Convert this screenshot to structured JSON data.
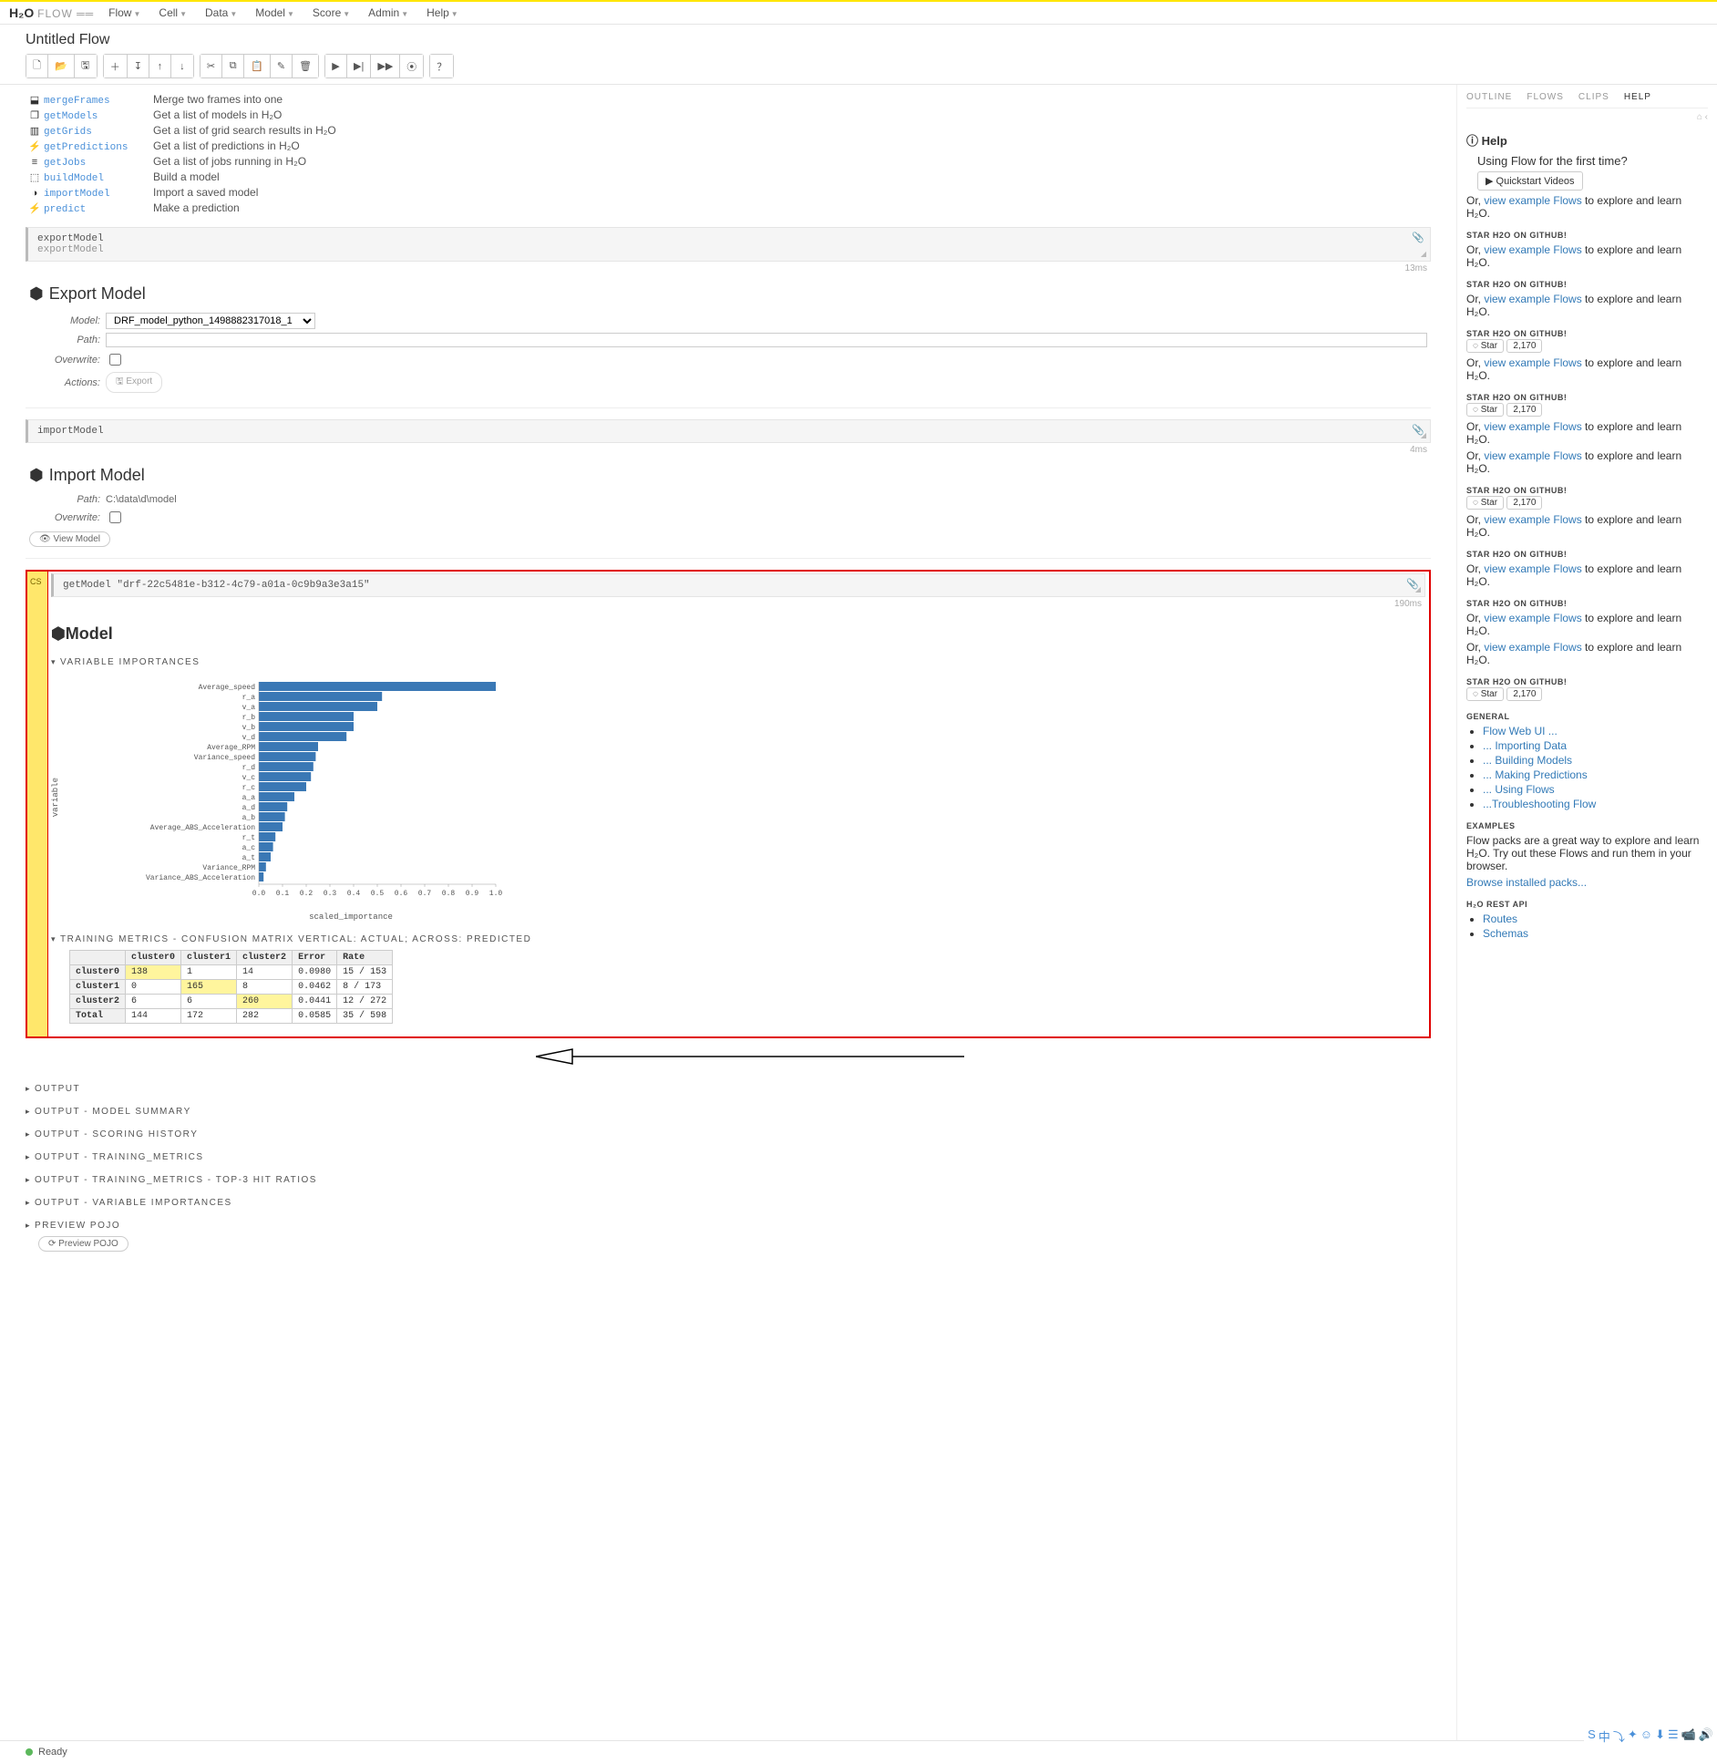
{
  "app": {
    "logo_main": "H₂O",
    "logo_sub": "FLOW",
    "title": "Untitled Flow"
  },
  "menus": [
    "Flow",
    "Cell",
    "Data",
    "Model",
    "Score",
    "Admin",
    "Help"
  ],
  "toolbar_groups": [
    [
      "new-file",
      "open-file",
      "save-file"
    ],
    [
      "insert-above",
      "insert-below",
      "move-up",
      "move-down"
    ],
    [
      "cut",
      "copy",
      "paste",
      "edit",
      "delete"
    ],
    [
      "run",
      "run-next",
      "run-all",
      "interrupt"
    ],
    [
      "help"
    ]
  ],
  "toolbar_icons": {
    "new-file": "🗋",
    "open-file": "📂",
    "save-file": "🖫",
    "insert-above": "＋",
    "insert-below": "↧",
    "move-up": "↑",
    "move-down": "↓",
    "cut": "✂",
    "copy": "⧉",
    "paste": "📋",
    "edit": "✎",
    "delete": "🗑",
    "run": "▶",
    "run-next": "▶|",
    "run-all": "▶▶",
    "interrupt": "⦿",
    "help": "？"
  },
  "commands": [
    {
      "icon": "⬓",
      "name": "mergeFrames",
      "desc": "Merge two frames into one"
    },
    {
      "icon": "❐",
      "name": "getModels",
      "desc": "Get a list of models in H₂O"
    },
    {
      "icon": "▥",
      "name": "getGrids",
      "desc": "Get a list of grid search results in H₂O"
    },
    {
      "icon": "⚡",
      "name": "getPredictions",
      "desc": "Get a list of predictions in H₂O"
    },
    {
      "icon": "≡",
      "name": "getJobs",
      "desc": "Get a list of jobs running in H₂O"
    },
    {
      "icon": "⬚",
      "name": "buildModel",
      "desc": "Build a model"
    },
    {
      "icon": "◑",
      "name": "importModel",
      "desc": "Import a saved model"
    },
    {
      "icon": "⚡",
      "name": "predict",
      "desc": "Make a prediction"
    }
  ],
  "export_cell": {
    "code": "exportModel",
    "echo": "exportModel",
    "time": "13ms",
    "title": "Export Model",
    "model_label": "Model:",
    "model_value": "DRF_model_python_1498882317018_1",
    "path_label": "Path:",
    "path_value": "",
    "overwrite_label": "Overwrite:",
    "overwrite_value": false,
    "actions_label": "Actions:",
    "export_btn": "Export"
  },
  "import_cell": {
    "code": "importModel",
    "time": "4ms",
    "title": "Import Model",
    "path_label": "Path:",
    "path_value": "C:\\data\\d\\model",
    "overwrite_label": "Overwrite:",
    "overwrite_value": false,
    "view_btn": "View Model"
  },
  "model_cell": {
    "gutter": "CS",
    "code": "getModel \"drf-22c5481e-b312-4c79-a01a-0c9b9a3e3a15\"",
    "time": "190ms",
    "title": "Model",
    "varimp_title": "VARIABLE IMPORTANCES",
    "cm_title": "TRAINING METRICS - CONFUSION MATRIX VERTICAL: ACTUAL; ACROSS: PREDICTED",
    "sections": [
      "OUTPUT",
      "OUTPUT - MODEL SUMMARY",
      "OUTPUT - SCORING HISTORY",
      "OUTPUT - TRAINING_METRICS",
      "OUTPUT - TRAINING_METRICS - TOP-3 HIT RATIOS",
      "OUTPUT - VARIABLE IMPORTANCES",
      "PREVIEW POJO"
    ],
    "pojo_btn": "Preview POJO"
  },
  "chart_data": {
    "type": "bar",
    "orientation": "horizontal",
    "ylabel": "variable",
    "xlabel": "scaled_importance",
    "xlim": [
      0.0,
      1.0
    ],
    "xticks": [
      0.0,
      0.1,
      0.2,
      0.3,
      0.4,
      0.5,
      0.6,
      0.7,
      0.8,
      0.9,
      1.0
    ],
    "categories": [
      "Average_speed",
      "r_a",
      "v_a",
      "r_b",
      "v_b",
      "v_d",
      "Average_RPM",
      "Variance_speed",
      "r_d",
      "v_c",
      "r_c",
      "a_a",
      "a_d",
      "a_b",
      "Average_ABS_Acceleration",
      "r_t",
      "a_c",
      "a_t",
      "Variance_RPM",
      "Variance_ABS_Acceleration"
    ],
    "values": [
      1.0,
      0.52,
      0.5,
      0.4,
      0.4,
      0.37,
      0.25,
      0.24,
      0.23,
      0.22,
      0.2,
      0.15,
      0.12,
      0.11,
      0.1,
      0.07,
      0.06,
      0.05,
      0.03,
      0.02
    ]
  },
  "confusion_matrix": {
    "headers": [
      "",
      "cluster0",
      "cluster1",
      "cluster2",
      "Error",
      "Rate"
    ],
    "rows": [
      {
        "label": "cluster0",
        "c0": "138",
        "c1": "1",
        "c2": "14",
        "err": "0.0980",
        "rate": "15 / 153",
        "hl": 0
      },
      {
        "label": "cluster1",
        "c0": "0",
        "c1": "165",
        "c2": "8",
        "err": "0.0462",
        "rate": "8 / 173",
        "hl": 1
      },
      {
        "label": "cluster2",
        "c0": "6",
        "c1": "6",
        "c2": "260",
        "err": "0.0441",
        "rate": "12 / 272",
        "hl": 2
      },
      {
        "label": "Total",
        "c0": "144",
        "c1": "172",
        "c2": "282",
        "err": "0.0585",
        "rate": "35 / 598",
        "hl": -1
      }
    ]
  },
  "sidebar": {
    "tabs": [
      "OUTLINE",
      "FLOWS",
      "CLIPS",
      "HELP"
    ],
    "active": 3,
    "help_title": "Help",
    "intro": "Using Flow for the first time?",
    "qs_btn": "Quickstart Videos",
    "or": "Or, ",
    "view_link": "view example Flows",
    "view_tail": " to explore and learn H₂O.",
    "star_title": "STAR H2O ON GITHUB!",
    "star_btn": "Star",
    "star_count": "2,170",
    "general_title": "GENERAL",
    "general_links": [
      "Flow Web UI ...",
      "... Importing Data",
      "... Building Models",
      "... Making Predictions",
      "... Using Flows",
      "...Troubleshooting Flow"
    ],
    "examples_title": "EXAMPLES",
    "examples_text": "Flow packs are a great way to explore and learn H₂O. Try out these Flows and run them in your browser.",
    "browse_link": "Browse installed packs...",
    "rest_title": "H₂O REST API",
    "rest_links": [
      "Routes",
      "Schemas"
    ]
  },
  "status": {
    "text": "Ready"
  },
  "tray": [
    "S",
    "中",
    "⤵",
    "✦",
    "☺",
    "⬇",
    "☰",
    "📹",
    "🔊"
  ]
}
